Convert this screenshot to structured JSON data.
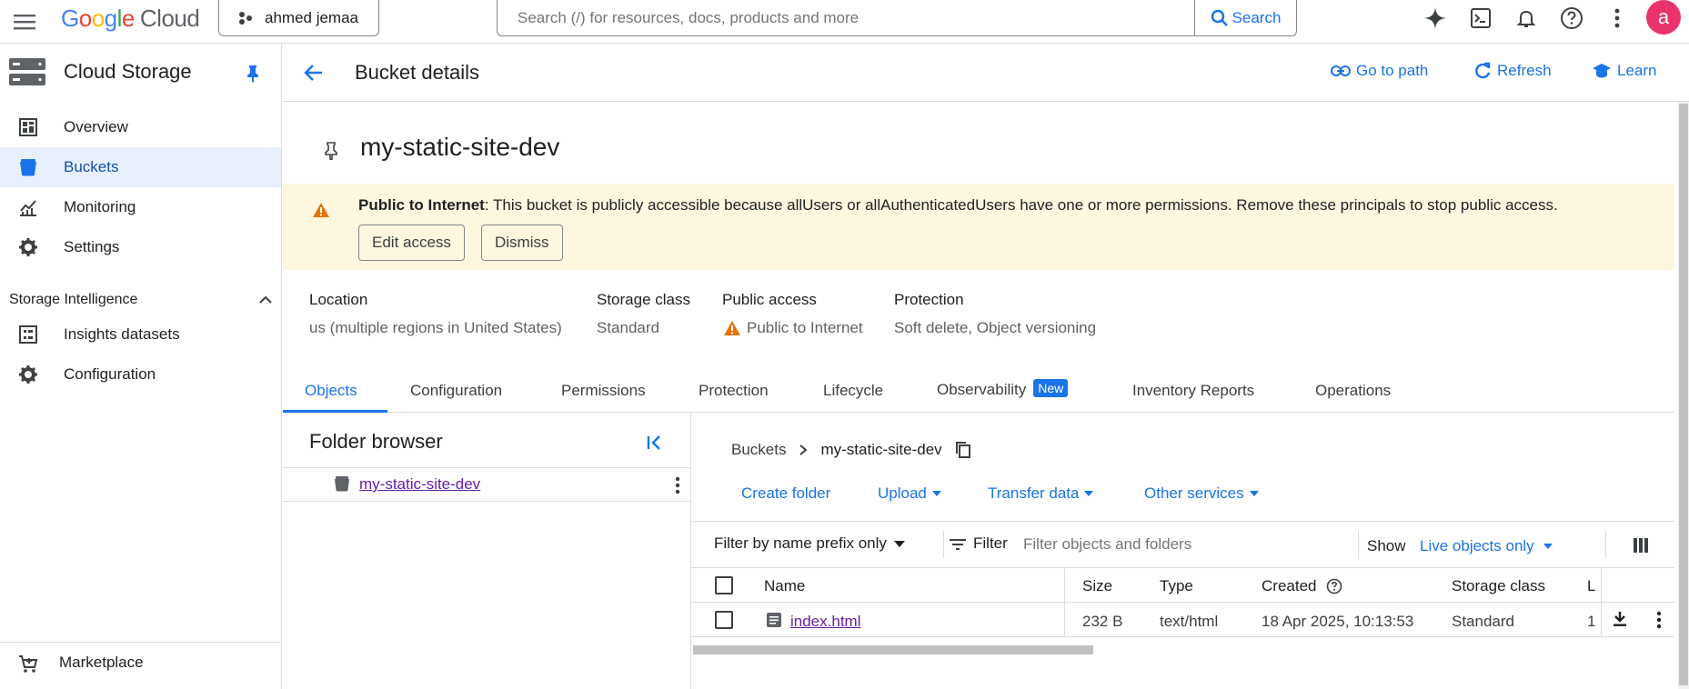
{
  "topbar": {
    "logo_letters": [
      "G",
      "o",
      "o",
      "g",
      "l",
      "e"
    ],
    "logo_suffix": "Cloud",
    "project": "ahmed jemaa",
    "search_placeholder": "Search (/) for resources, docs, products and more",
    "search_button": "Search",
    "avatar_letter": "a"
  },
  "sidebar": {
    "title": "Cloud Storage",
    "items": [
      {
        "label": "Overview",
        "icon": "dashboard-icon"
      },
      {
        "label": "Buckets",
        "icon": "bucket-icon",
        "active": true
      },
      {
        "label": "Monitoring",
        "icon": "chart-icon"
      },
      {
        "label": "Settings",
        "icon": "gear-icon"
      }
    ],
    "section": "Storage Intelligence",
    "section_items": [
      {
        "label": "Insights datasets",
        "icon": "dataset-icon"
      },
      {
        "label": "Configuration",
        "icon": "gear-icon"
      }
    ],
    "marketplace": "Marketplace"
  },
  "header": {
    "title": "Bucket details",
    "go_to_path": "Go to path",
    "refresh": "Refresh",
    "learn": "Learn"
  },
  "bucket": {
    "name": "my-static-site-dev"
  },
  "banner": {
    "bold": "Public to Internet",
    "text": ": This bucket is publicly accessible because allUsers or allAuthenticatedUsers have one or more permissions. Remove these principals to stop public access.",
    "edit_access": "Edit access",
    "dismiss": "Dismiss"
  },
  "info": {
    "location_label": "Location",
    "location_value": "us (multiple regions in United States)",
    "storage_class_label": "Storage class",
    "storage_class_value": "Standard",
    "public_access_label": "Public access",
    "public_access_value": "Public to Internet",
    "protection_label": "Protection",
    "protection_value": "Soft delete, Object versioning"
  },
  "tabs": {
    "objects": "Objects",
    "configuration": "Configuration",
    "permissions": "Permissions",
    "protection": "Protection",
    "lifecycle": "Lifecycle",
    "observability": "Observability",
    "new_badge": "New",
    "inventory": "Inventory Reports",
    "operations": "Operations"
  },
  "folder_browser": {
    "title": "Folder browser",
    "root": "my-static-site-dev"
  },
  "objects": {
    "crumb_root": "Buckets",
    "crumb_bucket": "my-static-site-dev",
    "create_folder": "Create folder",
    "upload": "Upload",
    "transfer_data": "Transfer data",
    "other_services": "Other services",
    "filter_mode": "Filter by name prefix only",
    "filter_label": "Filter",
    "filter_placeholder": "Filter objects and folders",
    "show_label": "Show",
    "show_value": "Live objects only",
    "columns": {
      "name": "Name",
      "size": "Size",
      "type": "Type",
      "created": "Created",
      "storage_class": "Storage class",
      "next": "L"
    },
    "rows": [
      {
        "name": "index.html",
        "size": "232 B",
        "type": "text/html",
        "created": "18 Apr 2025, 10:13:53",
        "storage_class": "Standard",
        "next": "1"
      }
    ]
  },
  "colors": {
    "accent": "#1a73e8",
    "warning": "#e37400",
    "banner_bg": "#fef7e0",
    "active_nav_bg": "#e8f0fe",
    "avatar_bg": "#e8336d"
  }
}
